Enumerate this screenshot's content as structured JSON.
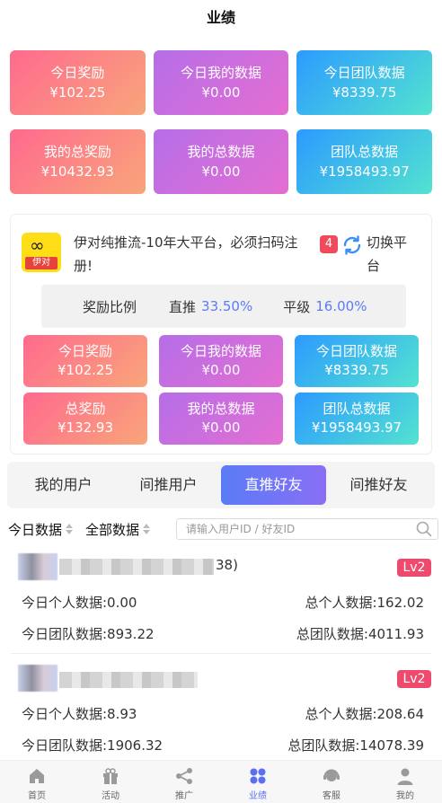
{
  "header": {
    "title": "业绩"
  },
  "top_cards": [
    {
      "title": "今日奖励",
      "value": "¥102.25"
    },
    {
      "title": "今日我的数据",
      "value": "¥0.00"
    },
    {
      "title": "今日团队数据",
      "value": "¥8339.75"
    },
    {
      "title": "我的总奖励",
      "value": "¥10432.93"
    },
    {
      "title": "我的总数据",
      "value": "¥0.00"
    },
    {
      "title": "团队总数据",
      "value": "¥1958493.97"
    }
  ],
  "platform": {
    "logo_text": "伊对",
    "description": "伊对纯推流-10年大平台，必须扫码注册!",
    "badge": "4",
    "switch_label": "切换平台",
    "ratio_label": "奖励比例",
    "direct_label": "直推",
    "direct_pct": "33.50%",
    "peer_label": "平级",
    "peer_pct": "16.00%",
    "cards": [
      {
        "title": "今日奖励",
        "value": "¥102.25"
      },
      {
        "title": "今日我的数据",
        "value": "¥0.00"
      },
      {
        "title": "今日团队数据",
        "value": "¥8339.75"
      },
      {
        "title": "总奖励",
        "value": "¥132.93"
      },
      {
        "title": "我的总数据",
        "value": "¥0.00"
      },
      {
        "title": "团队总数据",
        "value": "¥1958493.97"
      }
    ]
  },
  "tabs": [
    "我的用户",
    "间推用户",
    "直推好友",
    "间推好友"
  ],
  "active_tab": "直推好友",
  "filters": {
    "today": "今日数据",
    "all": "全部数据",
    "search_placeholder": "请输入用户ID / 好友ID"
  },
  "users": [
    {
      "id_suffix": "38)",
      "level": "Lv2",
      "today_personal": "今日个人数据:0.00",
      "total_personal": "总个人数据:162.02",
      "today_team": "今日团队数据:893.22",
      "total_team": "总团队数据:4011.93"
    },
    {
      "id_suffix": "",
      "level": "Lv2",
      "today_personal": "今日个人数据:8.93",
      "total_personal": "总个人数据:208.64",
      "today_team": "今日团队数据:1906.32",
      "total_team": "总团队数据:14078.39"
    }
  ],
  "bottom_nav": [
    {
      "label": "首页",
      "icon": "home-icon"
    },
    {
      "label": "活动",
      "icon": "gift-icon"
    },
    {
      "label": "推广",
      "icon": "share-icon"
    },
    {
      "label": "业绩",
      "icon": "performance-icon"
    },
    {
      "label": "客服",
      "icon": "customer-service-icon"
    },
    {
      "label": "我的",
      "icon": "profile-icon"
    }
  ],
  "colors": {
    "accent": "#5b6ef5",
    "level_badge": "#ee4a6e",
    "pct": "#5b7cf5"
  }
}
